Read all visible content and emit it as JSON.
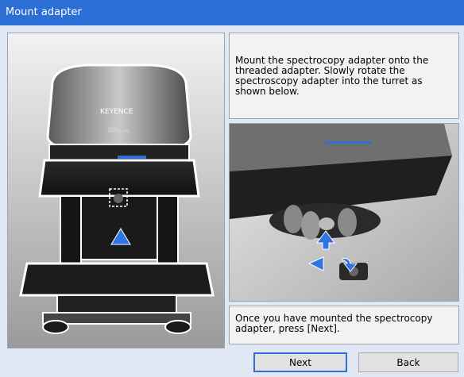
{
  "window": {
    "title": "Mount adapter"
  },
  "instructions": {
    "step_text": "Mount the spectrocopy adapter onto the threaded adapter. Slowly rotate the spectroscopy adapter into the turret as shown below.",
    "completion_text": "Once you have mounted the spectrocopy adapter, press [Next]."
  },
  "microscope": {
    "brand": "KEYENCE",
    "model_text": "LASER MICROSCOPE"
  },
  "buttons": {
    "next": "Next",
    "back": "Back"
  },
  "colors": {
    "title_bar": "#2b6fd6",
    "arrow": "#2f74e0",
    "accent_blue": "#2f6fd6"
  }
}
